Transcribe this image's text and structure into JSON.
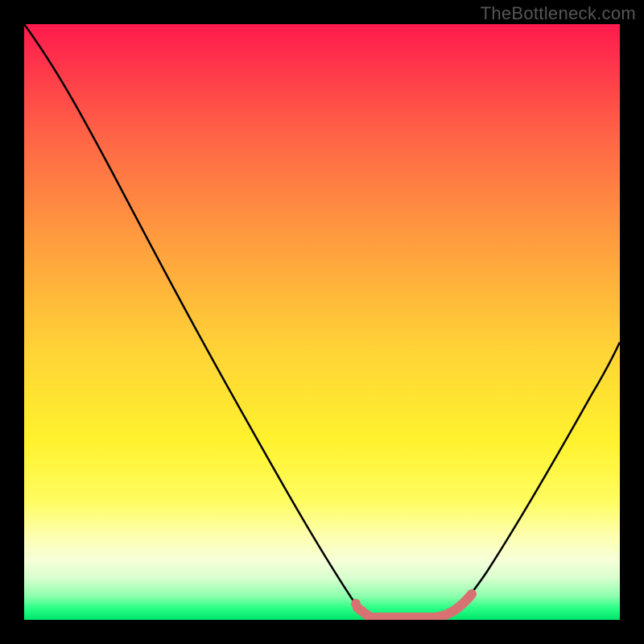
{
  "watermark": "TheBottleneck.com",
  "chart_data": {
    "type": "line",
    "title": "",
    "xlabel": "",
    "ylabel": "",
    "xlim": [
      0,
      100
    ],
    "ylim": [
      0,
      100
    ],
    "grid": false,
    "legend": false,
    "annotations": [],
    "series": [
      {
        "name": "bottleneck-curve",
        "x": [
          0,
          5,
          10,
          15,
          20,
          25,
          30,
          35,
          40,
          45,
          50,
          55,
          60,
          62,
          65,
          70,
          75,
          80,
          85,
          90,
          95,
          100
        ],
        "values": [
          100,
          91,
          82,
          73,
          64,
          55,
          46,
          38,
          30,
          22,
          14,
          7,
          2,
          0,
          0,
          0,
          5,
          12,
          20,
          30,
          41,
          53
        ]
      },
      {
        "name": "optimal-range-marker",
        "x": [
          55,
          60,
          65,
          70,
          73,
          75
        ],
        "values": [
          1,
          0,
          0,
          0,
          0.5,
          2
        ]
      }
    ],
    "colors": {
      "curve": "#000000",
      "marker": "#d87272"
    }
  }
}
